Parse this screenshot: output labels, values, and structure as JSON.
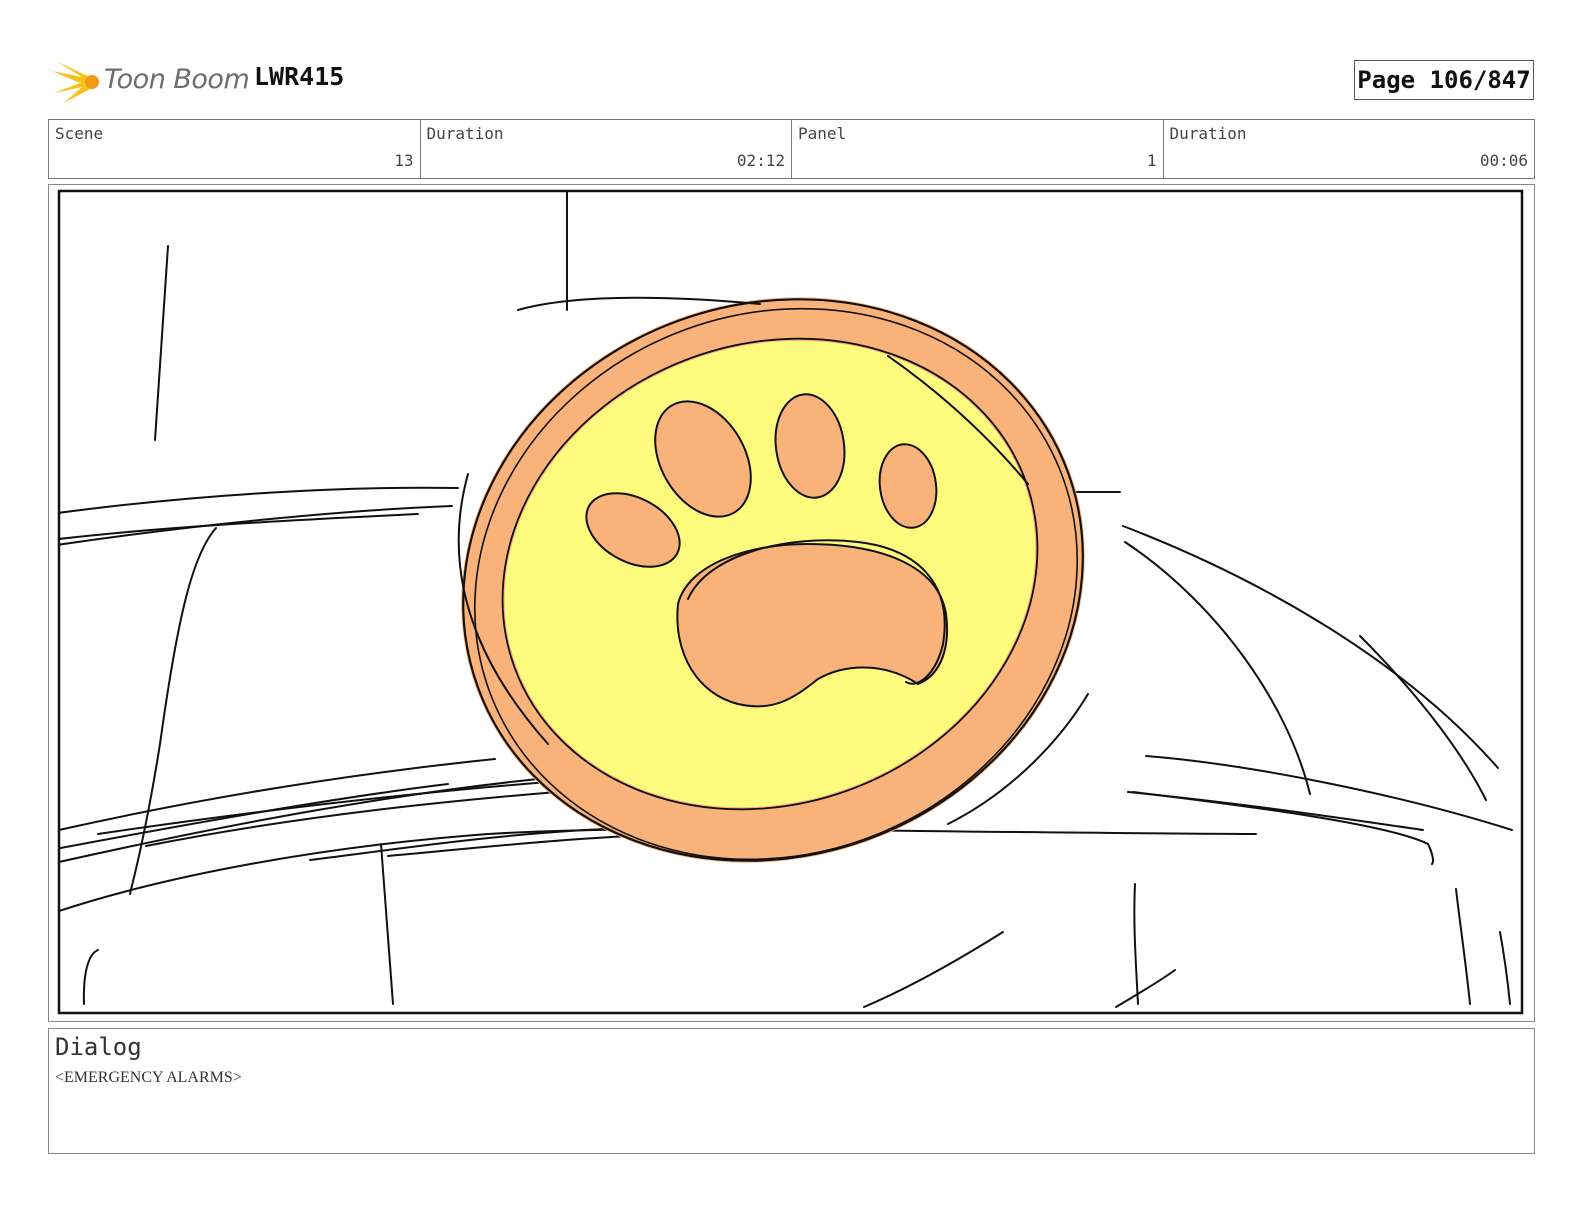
{
  "header": {
    "logo_text": "Toon Boom",
    "project": "LWR415",
    "page": "Page 106/847"
  },
  "info": {
    "scene_label": "Scene",
    "scene_value": "13",
    "duration_label": "Duration",
    "duration_value": "02:12",
    "panel_label": "Panel",
    "panel_value": "1",
    "panel_duration_label": "Duration",
    "panel_duration_value": "00:06"
  },
  "dialog": {
    "title": "Dialog",
    "text": "<EMERGENCY ALARMS>"
  },
  "colors": {
    "badge_fill": "#fdfb7d",
    "badge_rim": "#f9b37a",
    "ink": "#111111"
  },
  "icons": {
    "logo": "toon-boom-starburst-icon",
    "badge": "paw-print-icon"
  }
}
